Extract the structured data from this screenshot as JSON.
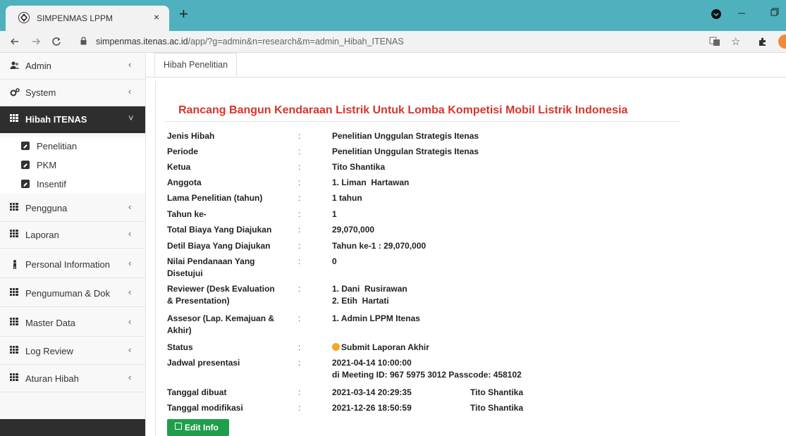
{
  "browser": {
    "tab_title": "SIMPENMAS LPPM",
    "tab_close": "×",
    "new_tab": "+",
    "url_domain": "simpenmas.itenas.ac.id",
    "url_path": "/app/?g=admin&n=research&m=admin_Hibah_ITENAS"
  },
  "sidebar": {
    "items": [
      {
        "label": "Admin",
        "icon": "users-icon"
      },
      {
        "label": "System",
        "icon": "gears-icon"
      },
      {
        "label": "Hibah ITENAS",
        "icon": "grid-icon",
        "active": true
      },
      {
        "label": "Pengguna",
        "icon": "grid-icon"
      },
      {
        "label": "Laporan",
        "icon": "grid-icon"
      },
      {
        "label": "Personal Information",
        "icon": "person-icon"
      },
      {
        "label": "Pengumuman & Dok",
        "icon": "grid-icon"
      },
      {
        "label": "Master Data",
        "icon": "grid-icon"
      },
      {
        "label": "Log Review",
        "icon": "grid-icon"
      },
      {
        "label": "Aturan Hibah",
        "icon": "grid-icon"
      }
    ],
    "submenu": [
      {
        "label": "Penelitian"
      },
      {
        "label": "PKM"
      },
      {
        "label": "Insentif"
      }
    ]
  },
  "main": {
    "tab_label": "Hibah Penelitian",
    "title": "Rancang Bangun Kendaraan Listrik Untuk Lomba Kompetisi Mobil Listrik Indonesia",
    "colon": ":",
    "fields": [
      {
        "label": "Jenis Hibah",
        "value": "Penelitian Unggulan Strategis Itenas"
      },
      {
        "label": "Periode",
        "value": "Penelitian Unggulan Strategis Itenas"
      },
      {
        "label": "Ketua",
        "value": "Tito Shantika"
      },
      {
        "label": "Anggota",
        "value": "1. Liman  Hartawan"
      },
      {
        "label": "Lama Penelitian (tahun)",
        "value": "1 tahun"
      },
      {
        "label": "Tahun ke-",
        "value": "1"
      },
      {
        "label": "Total Biaya Yang Diajukan",
        "value": "29,070,000"
      },
      {
        "label": "Detil Biaya Yang Diajukan",
        "value": "Tahun ke-1 : 29,070,000"
      },
      {
        "label": "Nilai Pendanaan Yang",
        "label2": "Disetujui",
        "value": "0"
      },
      {
        "label": "Reviewer (Desk Evaluation",
        "label2": "& Presentation)",
        "value": "1. Dani  Rusirawan",
        "value2": "2. Etih  Hartati"
      },
      {
        "label": "Assesor (Lap. Kemajuan &",
        "label2": "Akhir)",
        "value": "1. Admin LPPM Itenas"
      },
      {
        "label": "Status",
        "value": "Submit Laporan Akhir",
        "status_color": "#f5a623"
      },
      {
        "label": "Jadwal presentasi",
        "value": "2021-04-14 10:00:00",
        "value2": "di Meeting ID: 967 5975 3012 Passcode: 458102"
      },
      {
        "label": "Tanggal dibuat",
        "value": "2021-03-14 20:29:35",
        "by": "Tito Shantika"
      },
      {
        "label": "Tanggal modifikasi",
        "value": "2021-12-26 18:50:59",
        "by": "Tito Shantika"
      }
    ],
    "edit_button": "Edit Info"
  },
  "colors": {
    "browser_bar": "#4FB1BE",
    "title": "#d9342b",
    "edit_button": "#1f9e4c",
    "sidebar_active": "#2e2e2e"
  }
}
